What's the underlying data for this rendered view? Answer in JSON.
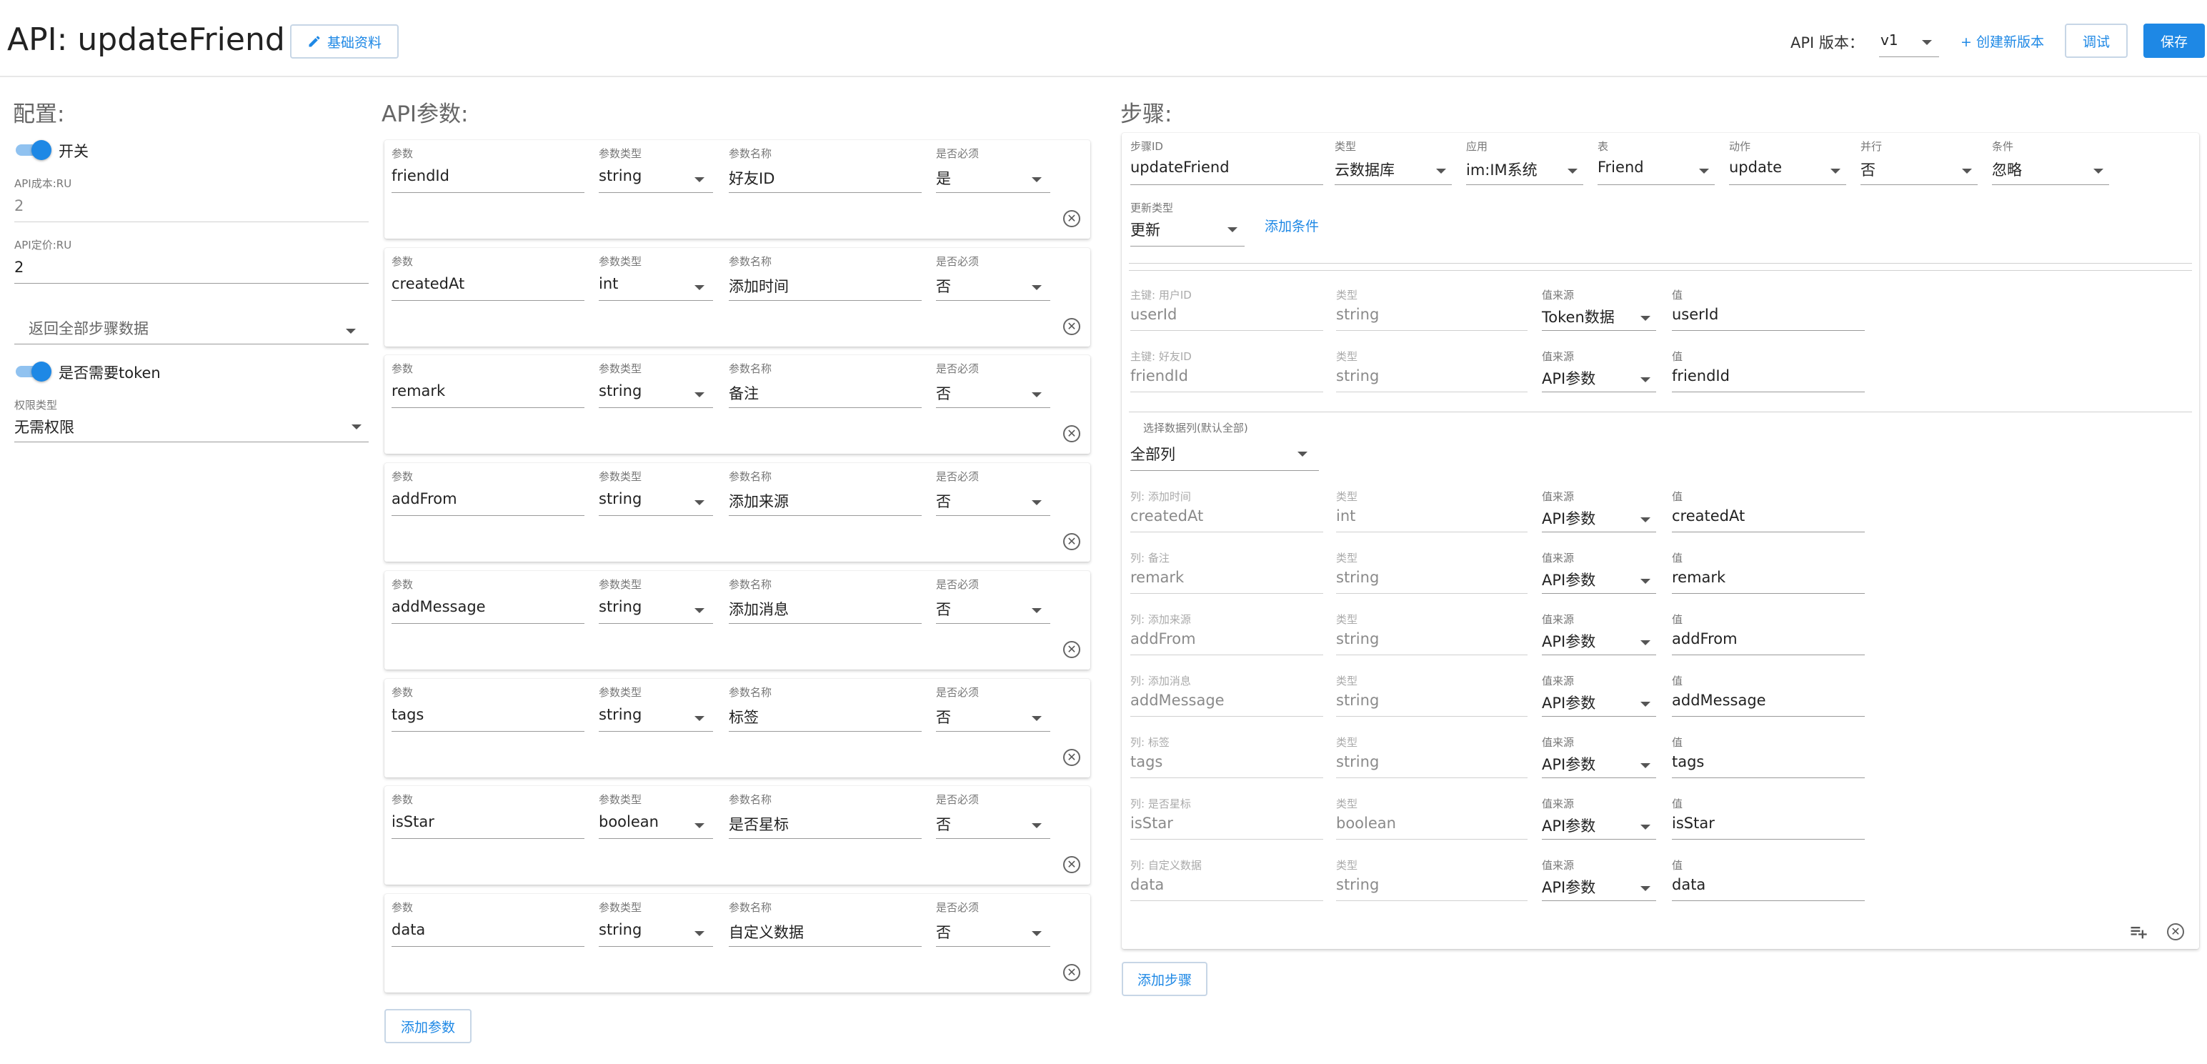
{
  "header": {
    "title": "API: updateFriend",
    "basic_info_button": "基础资料",
    "version_label": "API 版本：",
    "version_value": "v1",
    "create_version_link": "+ 创建新版本",
    "debug_button": "调试",
    "save_button": "保存"
  },
  "config": {
    "title": "配置:",
    "switch_label": "开关",
    "cost_label": "API成本:RU",
    "cost_value": "2",
    "price_label": "API定价:RU",
    "price_value": "2",
    "return_select": "返回全部步骤数据",
    "token_label": "是否需要token",
    "permission_label": "权限类型",
    "permission_value": "无需权限"
  },
  "params": {
    "title": "API参数:",
    "labels": {
      "param": "参数",
      "type": "参数类型",
      "name": "参数名称",
      "required": "是否必须"
    },
    "rows": [
      {
        "param": "friendId",
        "type": "string",
        "name": "好友ID",
        "required": "是"
      },
      {
        "param": "createdAt",
        "type": "int",
        "name": "添加时间",
        "required": "否"
      },
      {
        "param": "remark",
        "type": "string",
        "name": "备注",
        "required": "否"
      },
      {
        "param": "addFrom",
        "type": "string",
        "name": "添加来源",
        "required": "否"
      },
      {
        "param": "addMessage",
        "type": "string",
        "name": "添加消息",
        "required": "否"
      },
      {
        "param": "tags",
        "type": "string",
        "name": "标签",
        "required": "否"
      },
      {
        "param": "isStar",
        "type": "boolean",
        "name": "是否星标",
        "required": "否"
      },
      {
        "param": "data",
        "type": "string",
        "name": "自定义数据",
        "required": "否"
      }
    ],
    "add_button": "添加参数"
  },
  "steps": {
    "title": "步骤:",
    "top_fields": [
      {
        "label": "步骤ID",
        "required": true,
        "value": "updateFriend",
        "select": false
      },
      {
        "label": "类型",
        "required": false,
        "value": "云数据库",
        "select": true
      },
      {
        "label": "应用",
        "required": true,
        "value": "im:IM系统",
        "select": true
      },
      {
        "label": "表",
        "required": true,
        "value": "Friend",
        "select": true
      },
      {
        "label": "动作",
        "required": true,
        "value": "update",
        "select": true
      },
      {
        "label": "并行",
        "required": false,
        "value": "否",
        "select": true
      },
      {
        "label": "条件",
        "required": false,
        "value": "忽略",
        "select": true
      }
    ],
    "update_type_label": "更新类型",
    "update_type_value": "更新",
    "add_condition": "添加条件",
    "col_labels": {
      "type": "类型",
      "source": "值来源",
      "value": "值"
    },
    "key_rows": [
      {
        "label": "主键: 用户ID",
        "field": "userId",
        "type": "string",
        "source": "Token数据",
        "value": "userId"
      },
      {
        "label": "主键: 好友ID",
        "field": "friendId",
        "type": "string",
        "source": "API参数",
        "value": "friendId"
      }
    ],
    "select_columns_label": "选择数据列(默认全部)",
    "select_columns_value": "全部列",
    "col_rows": [
      {
        "label": "列: 添加时间",
        "field": "createdAt",
        "type": "int",
        "source": "API参数",
        "value": "createdAt"
      },
      {
        "label": "列: 备注",
        "field": "remark",
        "type": "string",
        "source": "API参数",
        "value": "remark"
      },
      {
        "label": "列: 添加来源",
        "field": "addFrom",
        "type": "string",
        "source": "API参数",
        "value": "addFrom"
      },
      {
        "label": "列: 添加消息",
        "field": "addMessage",
        "type": "string",
        "source": "API参数",
        "value": "addMessage"
      },
      {
        "label": "列: 标签",
        "field": "tags",
        "type": "string",
        "source": "API参数",
        "value": "tags"
      },
      {
        "label": "列: 是否星标",
        "field": "isStar",
        "type": "boolean",
        "source": "API参数",
        "value": "isStar"
      },
      {
        "label": "列: 自定义数据",
        "field": "data",
        "type": "string",
        "source": "API参数",
        "value": "data"
      }
    ],
    "add_step_button": "添加步骤"
  },
  "colors": {
    "primary": "#1e88e5",
    "toggle_track": "#90c2f0"
  },
  "icons": {
    "edit": "pencil-icon",
    "dropdown": "chevron-down-icon",
    "remove": "close-circle-icon",
    "add_row": "playlist-add-icon"
  }
}
